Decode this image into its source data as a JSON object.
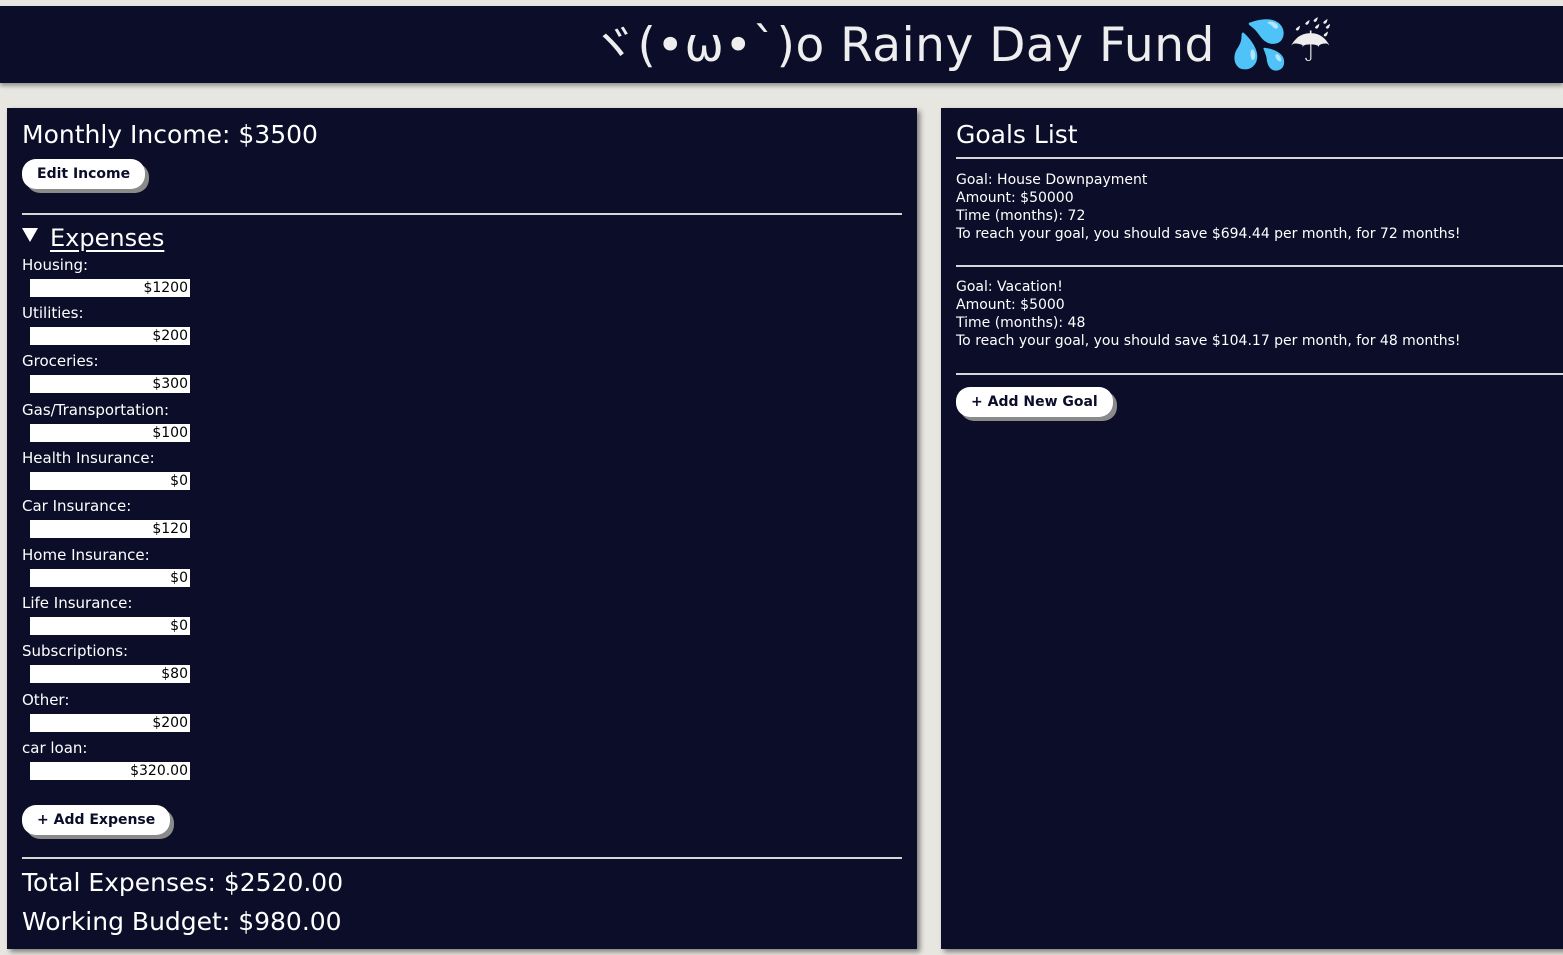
{
  "header": {
    "title": "ヾ(•ω•`)o Rainy Day Fund 💦☔"
  },
  "budget": {
    "income_text": "Monthly Income: $3500",
    "edit_income_label": "Edit Income",
    "expenses_heading": "Expenses",
    "expenses": [
      {
        "label": "Housing:",
        "value": "$1200"
      },
      {
        "label": "Utilities:",
        "value": "$200"
      },
      {
        "label": "Groceries:",
        "value": "$300"
      },
      {
        "label": "Gas/Transportation:",
        "value": "$100"
      },
      {
        "label": "Health Insurance:",
        "value": "$0"
      },
      {
        "label": "Car Insurance:",
        "value": "$120"
      },
      {
        "label": "Home Insurance:",
        "value": "$0"
      },
      {
        "label": "Life Insurance:",
        "value": "$0"
      },
      {
        "label": "Subscriptions:",
        "value": "$80"
      },
      {
        "label": "Other:",
        "value": "$200"
      },
      {
        "label": "car loan:",
        "value": "$320.00"
      }
    ],
    "add_expense_label": "+ Add Expense",
    "total_expenses_text": "Total Expenses: $2520.00",
    "working_budget_text": "Working Budget: $980.00"
  },
  "goals": {
    "heading": "Goals List",
    "items": [
      {
        "goal": "Goal: House Downpayment",
        "amount": "Amount: $50000",
        "time": "Time (months): 72",
        "advice": "To reach your goal, you should save $694.44 per month, for 72 months!"
      },
      {
        "goal": "Goal: Vacation!",
        "amount": "Amount: $5000",
        "time": "Time (months): 48",
        "advice": "To reach your goal, you should save $104.17 per month, for 48 months!"
      }
    ],
    "add_goal_label": "+ Add New Goal"
  },
  "colors": {
    "panel_background": "#0b0d29",
    "page_background": "#e8e6e1",
    "text": "#ffffff"
  }
}
